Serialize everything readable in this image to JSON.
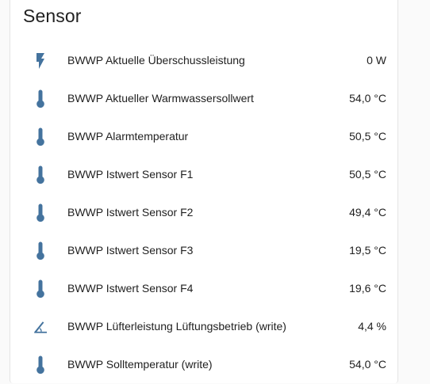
{
  "card": {
    "title": "Sensor"
  },
  "colors": {
    "icon": "#44739e",
    "text": "#212121",
    "card_bg": "#ffffff",
    "page_bg": "#fafafa"
  },
  "rows": [
    {
      "icon": "flash-icon",
      "label": "BWWP Aktuelle Überschussleistung",
      "value": "0 W"
    },
    {
      "icon": "thermometer-icon",
      "label": "BWWP Aktueller Warmwassersollwert",
      "value": "54,0 °C"
    },
    {
      "icon": "thermometer-icon",
      "label": "BWWP Alarmtemperatur",
      "value": "50,5 °C"
    },
    {
      "icon": "thermometer-icon",
      "label": "BWWP Istwert Sensor F1",
      "value": "50,5 °C"
    },
    {
      "icon": "thermometer-icon",
      "label": "BWWP Istwert Sensor F2",
      "value": "49,4 °C"
    },
    {
      "icon": "thermometer-icon",
      "label": "BWWP Istwert Sensor F3",
      "value": "19,5 °C"
    },
    {
      "icon": "thermometer-icon",
      "label": "BWWP Istwert Sensor F4",
      "value": "19,6 °C"
    },
    {
      "icon": "angle-acute-icon",
      "label": "BWWP Lüfterleistung Lüftungsbetrieb (write)",
      "value": "4,4 %"
    },
    {
      "icon": "thermometer-icon",
      "label": "BWWP Solltemperatur (write)",
      "value": "54,0 °C"
    }
  ]
}
